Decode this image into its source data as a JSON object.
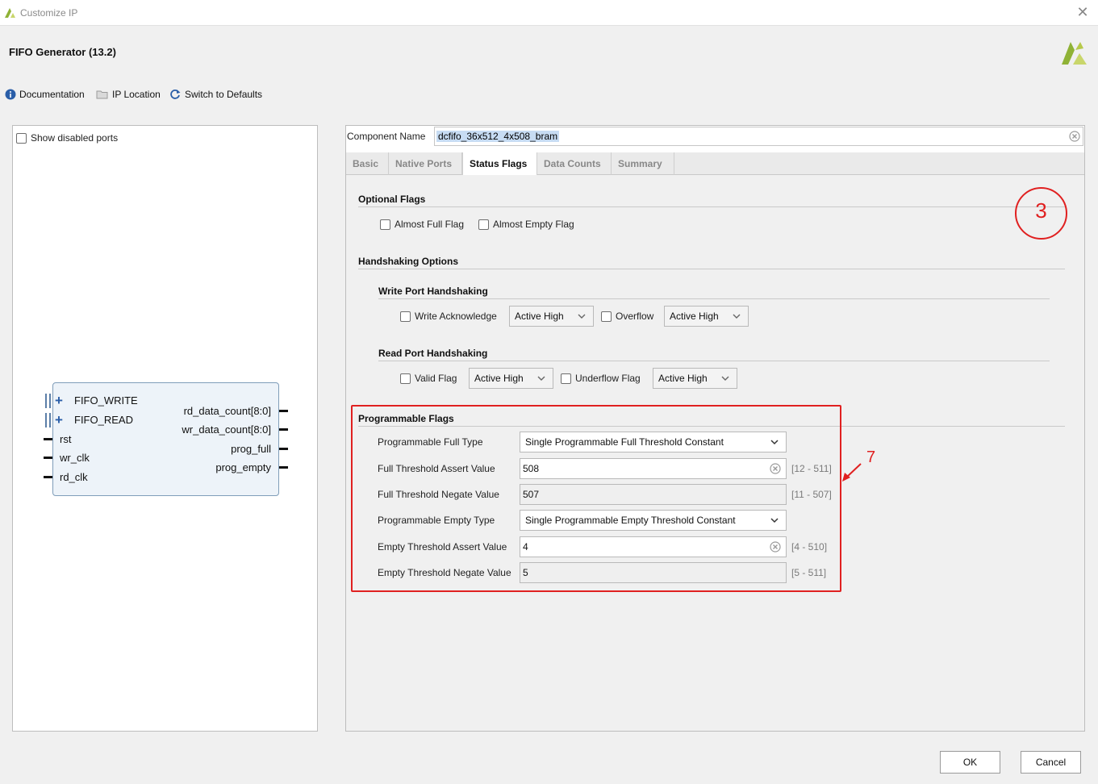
{
  "window": {
    "title": "Customize IP",
    "app_title": "FIFO Generator (13.2)"
  },
  "toolbar": {
    "documentation": "Documentation",
    "ip_location": "IP Location",
    "switch_defaults": "Switch to Defaults"
  },
  "left": {
    "show_disabled_ports": "Show disabled ports",
    "symbol": {
      "buses": [
        "FIFO_WRITE",
        "FIFO_READ"
      ],
      "inputs": [
        "rst",
        "wr_clk",
        "rd_clk"
      ],
      "outputs": [
        "rd_data_count[8:0]",
        "wr_data_count[8:0]",
        "prog_full",
        "prog_empty"
      ]
    }
  },
  "component": {
    "label": "Component Name",
    "value": "dcfifo_36x512_4x508_bram"
  },
  "tabs": [
    "Basic",
    "Native Ports",
    "Status Flags",
    "Data Counts",
    "Summary"
  ],
  "active_tab": "Status Flags",
  "optional_flags": {
    "title": "Optional Flags",
    "almost_full": "Almost Full Flag",
    "almost_empty": "Almost Empty Flag"
  },
  "handshaking": {
    "title": "Handshaking Options",
    "write_title": "Write Port Handshaking",
    "write_ack": "Write Acknowledge",
    "write_ack_sel": "Active High",
    "overflow": "Overflow",
    "overflow_sel": "Active High",
    "read_title": "Read Port Handshaking",
    "valid": "Valid Flag",
    "valid_sel": "Active High",
    "underflow": "Underflow Flag",
    "underflow_sel": "Active High"
  },
  "prog_flags": {
    "title": "Programmable Flags",
    "full_type_label": "Programmable Full Type",
    "full_type_value": "Single Programmable Full Threshold Constant",
    "full_assert_label": "Full Threshold Assert Value",
    "full_assert_value": "508",
    "full_assert_range": "[12 - 511]",
    "full_negate_label": "Full Threshold Negate Value",
    "full_negate_value": "507",
    "full_negate_range": "[11 - 507]",
    "empty_type_label": "Programmable Empty Type",
    "empty_type_value": "Single Programmable Empty Threshold Constant",
    "empty_assert_label": "Empty Threshold Assert Value",
    "empty_assert_value": "4",
    "empty_assert_range": "[4 - 510]",
    "empty_negate_label": "Empty Threshold Negate Value",
    "empty_negate_value": "5",
    "empty_negate_range": "[5 - 511]"
  },
  "annotations": {
    "circle_number": "3",
    "arrow_number": "7",
    "color": "#e02020"
  },
  "buttons": {
    "ok": "OK",
    "cancel": "Cancel"
  },
  "colors": {
    "xilinx_logo": "#8fb236",
    "info_icon": "#2a5ea8",
    "symbol_fill": "#edf3f9"
  }
}
